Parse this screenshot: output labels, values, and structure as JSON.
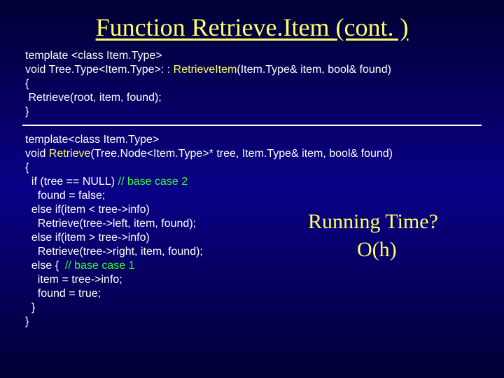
{
  "title": "Function Retrieve.Item (cont. )",
  "block1": {
    "l0": "template <class Item.Type>",
    "l1a": "void Tree.Type<Item.Type>: : ",
    "l1b": "RetrieveItem",
    "l1c": "(Item.Type& item, bool& found)",
    "l2": "{",
    "l3": " Retrieve(root, item, found);",
    "l4": "}"
  },
  "block2": {
    "l0": "template<class Item.Type>",
    "l1a": "void ",
    "l1b": "Retrieve",
    "l1c": "(Tree.Node<Item.Type>* tree, Item.Type& item, bool& found)",
    "l2": "{",
    "l3a": "  if (tree == NULL) ",
    "l3b": "// base case 2",
    "l4": "    found = false;",
    "l5": "  else if(item < tree->info)",
    "l6": "    Retrieve(tree->left, item, found);",
    "l7": "  else if(item > tree->info)",
    "l8": "    Retrieve(tree->right, item, found);",
    "l9a": "  else {  ",
    "l9b": "// base case 1",
    "l10": "    item = tree->info;",
    "l11": "    found = true;",
    "l12": "  }",
    "l13": "}"
  },
  "annotation": {
    "question": "Running Time?",
    "answer": "O(h)"
  }
}
